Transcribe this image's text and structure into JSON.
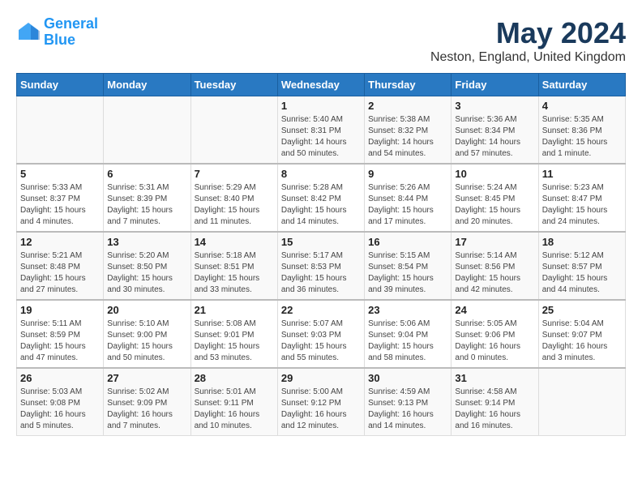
{
  "logo": {
    "line1": "General",
    "line2": "Blue"
  },
  "title": "May 2024",
  "location": "Neston, England, United Kingdom",
  "days_header": [
    "Sunday",
    "Monday",
    "Tuesday",
    "Wednesday",
    "Thursday",
    "Friday",
    "Saturday"
  ],
  "weeks": [
    [
      {
        "day": "",
        "info": ""
      },
      {
        "day": "",
        "info": ""
      },
      {
        "day": "",
        "info": ""
      },
      {
        "day": "1",
        "info": "Sunrise: 5:40 AM\nSunset: 8:31 PM\nDaylight: 14 hours\nand 50 minutes."
      },
      {
        "day": "2",
        "info": "Sunrise: 5:38 AM\nSunset: 8:32 PM\nDaylight: 14 hours\nand 54 minutes."
      },
      {
        "day": "3",
        "info": "Sunrise: 5:36 AM\nSunset: 8:34 PM\nDaylight: 14 hours\nand 57 minutes."
      },
      {
        "day": "4",
        "info": "Sunrise: 5:35 AM\nSunset: 8:36 PM\nDaylight: 15 hours\nand 1 minute."
      }
    ],
    [
      {
        "day": "5",
        "info": "Sunrise: 5:33 AM\nSunset: 8:37 PM\nDaylight: 15 hours\nand 4 minutes."
      },
      {
        "day": "6",
        "info": "Sunrise: 5:31 AM\nSunset: 8:39 PM\nDaylight: 15 hours\nand 7 minutes."
      },
      {
        "day": "7",
        "info": "Sunrise: 5:29 AM\nSunset: 8:40 PM\nDaylight: 15 hours\nand 11 minutes."
      },
      {
        "day": "8",
        "info": "Sunrise: 5:28 AM\nSunset: 8:42 PM\nDaylight: 15 hours\nand 14 minutes."
      },
      {
        "day": "9",
        "info": "Sunrise: 5:26 AM\nSunset: 8:44 PM\nDaylight: 15 hours\nand 17 minutes."
      },
      {
        "day": "10",
        "info": "Sunrise: 5:24 AM\nSunset: 8:45 PM\nDaylight: 15 hours\nand 20 minutes."
      },
      {
        "day": "11",
        "info": "Sunrise: 5:23 AM\nSunset: 8:47 PM\nDaylight: 15 hours\nand 24 minutes."
      }
    ],
    [
      {
        "day": "12",
        "info": "Sunrise: 5:21 AM\nSunset: 8:48 PM\nDaylight: 15 hours\nand 27 minutes."
      },
      {
        "day": "13",
        "info": "Sunrise: 5:20 AM\nSunset: 8:50 PM\nDaylight: 15 hours\nand 30 minutes."
      },
      {
        "day": "14",
        "info": "Sunrise: 5:18 AM\nSunset: 8:51 PM\nDaylight: 15 hours\nand 33 minutes."
      },
      {
        "day": "15",
        "info": "Sunrise: 5:17 AM\nSunset: 8:53 PM\nDaylight: 15 hours\nand 36 minutes."
      },
      {
        "day": "16",
        "info": "Sunrise: 5:15 AM\nSunset: 8:54 PM\nDaylight: 15 hours\nand 39 minutes."
      },
      {
        "day": "17",
        "info": "Sunrise: 5:14 AM\nSunset: 8:56 PM\nDaylight: 15 hours\nand 42 minutes."
      },
      {
        "day": "18",
        "info": "Sunrise: 5:12 AM\nSunset: 8:57 PM\nDaylight: 15 hours\nand 44 minutes."
      }
    ],
    [
      {
        "day": "19",
        "info": "Sunrise: 5:11 AM\nSunset: 8:59 PM\nDaylight: 15 hours\nand 47 minutes."
      },
      {
        "day": "20",
        "info": "Sunrise: 5:10 AM\nSunset: 9:00 PM\nDaylight: 15 hours\nand 50 minutes."
      },
      {
        "day": "21",
        "info": "Sunrise: 5:08 AM\nSunset: 9:01 PM\nDaylight: 15 hours\nand 53 minutes."
      },
      {
        "day": "22",
        "info": "Sunrise: 5:07 AM\nSunset: 9:03 PM\nDaylight: 15 hours\nand 55 minutes."
      },
      {
        "day": "23",
        "info": "Sunrise: 5:06 AM\nSunset: 9:04 PM\nDaylight: 15 hours\nand 58 minutes."
      },
      {
        "day": "24",
        "info": "Sunrise: 5:05 AM\nSunset: 9:06 PM\nDaylight: 16 hours\nand 0 minutes."
      },
      {
        "day": "25",
        "info": "Sunrise: 5:04 AM\nSunset: 9:07 PM\nDaylight: 16 hours\nand 3 minutes."
      }
    ],
    [
      {
        "day": "26",
        "info": "Sunrise: 5:03 AM\nSunset: 9:08 PM\nDaylight: 16 hours\nand 5 minutes."
      },
      {
        "day": "27",
        "info": "Sunrise: 5:02 AM\nSunset: 9:09 PM\nDaylight: 16 hours\nand 7 minutes."
      },
      {
        "day": "28",
        "info": "Sunrise: 5:01 AM\nSunset: 9:11 PM\nDaylight: 16 hours\nand 10 minutes."
      },
      {
        "day": "29",
        "info": "Sunrise: 5:00 AM\nSunset: 9:12 PM\nDaylight: 16 hours\nand 12 minutes."
      },
      {
        "day": "30",
        "info": "Sunrise: 4:59 AM\nSunset: 9:13 PM\nDaylight: 16 hours\nand 14 minutes."
      },
      {
        "day": "31",
        "info": "Sunrise: 4:58 AM\nSunset: 9:14 PM\nDaylight: 16 hours\nand 16 minutes."
      },
      {
        "day": "",
        "info": ""
      }
    ]
  ]
}
